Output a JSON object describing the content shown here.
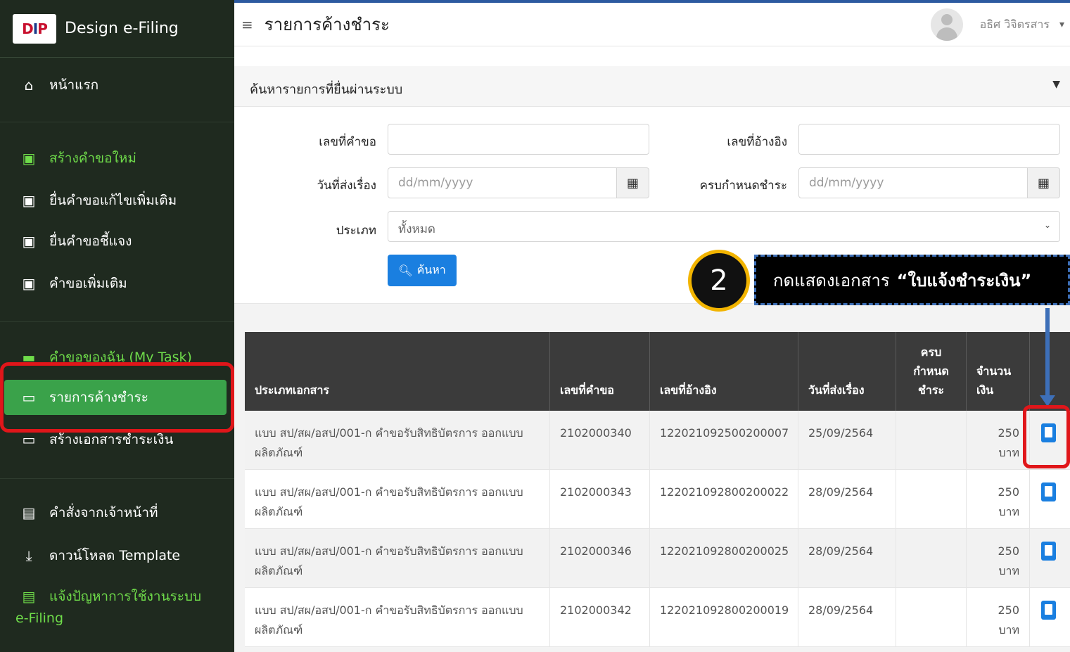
{
  "brand": {
    "logo": "DIP",
    "title": "Design e-Filing"
  },
  "sidebar": {
    "items": [
      {
        "label": "หน้าแรก",
        "icon": "home-icon"
      },
      {
        "label": "สร้างคำขอใหม่",
        "icon": "file-plus-icon"
      },
      {
        "label": "ยื่นคำขอแก้ไขเพิ่มเติม",
        "icon": "file-plus-icon"
      },
      {
        "label": "ยื่นคำขอชี้แจง",
        "icon": "file-plus-icon"
      },
      {
        "label": "คำขอเพิ่มเติม",
        "icon": "file-plus-icon"
      },
      {
        "label": "คำขอของฉัน (My Task)",
        "icon": "folder-icon"
      },
      {
        "label": "รายการค้างชำระ",
        "icon": "payment-card-icon"
      },
      {
        "label": "สร้างเอกสารชำระเงิน",
        "icon": "payment-card-icon"
      },
      {
        "label": "คำสั่งจากเจ้าหน้าที่",
        "icon": "file-icon"
      },
      {
        "label": "ดาวน์โหลด Template",
        "icon": "download-icon"
      },
      {
        "label": "แจ้งปัญหาการใช้งานระบบ",
        "icon": "file-icon"
      }
    ],
    "report_tail": "e-Filing"
  },
  "header": {
    "title": "รายการค้างชำระ",
    "user_name": "อธิศ วิจิตรสาร"
  },
  "search": {
    "panel_title": "ค้นหารายการที่ยื่นผ่านระบบ",
    "request_no_label": "เลขที่คำขอ",
    "reference_no_label": "เลขที่อ้างอิง",
    "submit_date_label": "วันที่ส่งเรื่อง",
    "due_date_label": "ครบกำหนดชำระ",
    "date_placeholder": "dd/mm/yyyy",
    "type_label": "ประเภท",
    "type_value": "ทั้งหมด",
    "search_button": "ค้นหา"
  },
  "annotation": {
    "step": "2",
    "text": "กดแสดงเอกสาร",
    "bold_text": "“ใบแจ้งชำระเงิน”"
  },
  "table": {
    "headers": [
      "ประเภทเอกสาร",
      "เลขที่คำขอ",
      "เลขที่อ้างอิง",
      "วันที่ส่งเรื่อง",
      "ครบ\nกำหนด\nชำระ",
      "จำนวน\nเงิน"
    ],
    "rows": [
      {
        "doc_type": "แบบ สป/สผ/อสป/001-ก คำขอรับสิทธิบัตรการ ออกแบบผลิตภัณฑ์",
        "request_no": "2102000340",
        "reference_no": "122021092500200007",
        "submit_date": "25/09/2564",
        "due_date": "",
        "amount": "250",
        "unit": "บาท"
      },
      {
        "doc_type": "แบบ สป/สผ/อสป/001-ก คำขอรับสิทธิบัตรการ ออกแบบผลิตภัณฑ์",
        "request_no": "2102000343",
        "reference_no": "122021092800200022",
        "submit_date": "28/09/2564",
        "due_date": "",
        "amount": "250",
        "unit": "บาท"
      },
      {
        "doc_type": "แบบ สป/สผ/อสป/001-ก คำขอรับสิทธิบัตรการ ออกแบบผลิตภัณฑ์",
        "request_no": "2102000346",
        "reference_no": "122021092800200025",
        "submit_date": "28/09/2564",
        "due_date": "",
        "amount": "250",
        "unit": "บาท"
      },
      {
        "doc_type": "แบบ สป/สผ/อสป/001-ก คำขอรับสิทธิบัตรการ ออกแบบผลิตภัณฑ์",
        "request_no": "2102000342",
        "reference_no": "122021092800200019",
        "submit_date": "28/09/2564",
        "due_date": "",
        "amount": "250",
        "unit": "บาท"
      }
    ]
  },
  "colors": {
    "sidebar_bg": "#1f2a1f",
    "active_green": "#3aa24a",
    "accent_green": "#6fdc4a",
    "primary_blue": "#1a7fe0",
    "highlight_red": "#e0161a",
    "step_ring": "#f2b400"
  }
}
